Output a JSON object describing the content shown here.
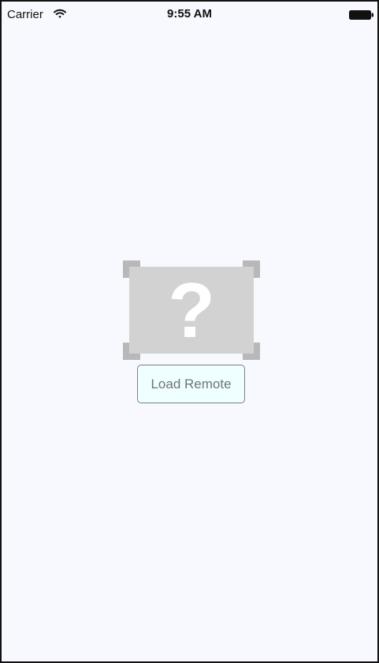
{
  "status_bar": {
    "carrier": "Carrier",
    "time": "9:55 AM",
    "wifi_icon": "wifi-icon",
    "battery_icon": "battery-icon"
  },
  "main": {
    "image_placeholder": {
      "icon": "question-mark-image-placeholder-icon",
      "glyph": "?"
    },
    "load_button": {
      "label": "Load Remote"
    }
  },
  "colors": {
    "background": "#f8f9fe",
    "button_fill": "#effeff",
    "button_border": "#7b8087",
    "button_text": "#6f747a",
    "placeholder_fill": "#d2d2d2",
    "placeholder_corners": "#b8b8b8",
    "placeholder_glyph": "#ffffff"
  }
}
